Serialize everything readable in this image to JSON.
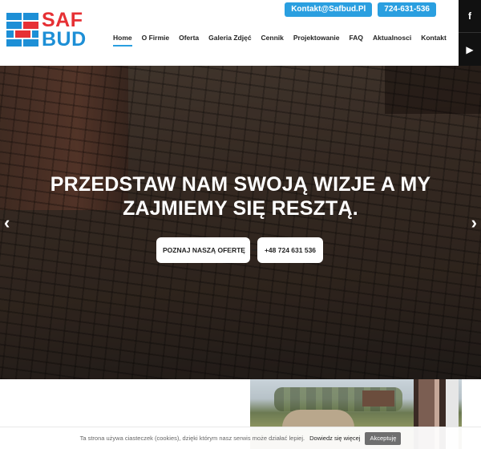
{
  "brand": {
    "logo_line1": "SAF",
    "logo_line2": "BUD",
    "colors": {
      "red": "#e63034",
      "blue": "#1d8fd6",
      "accent": "#2a9fe0"
    }
  },
  "header": {
    "email_label": "Kontakt@Safbud.Pl",
    "phone_label": "724-631-536"
  },
  "nav": {
    "items": [
      {
        "label": "Home",
        "active": true
      },
      {
        "label": "O Firmie"
      },
      {
        "label": "Oferta"
      },
      {
        "label": "Galeria Zdjęć"
      },
      {
        "label": "Cennik"
      },
      {
        "label": "Projektowanie"
      },
      {
        "label": "FAQ"
      },
      {
        "label": "Aktualnosci"
      },
      {
        "label": "Kontakt"
      }
    ]
  },
  "social": {
    "facebook_glyph": "f",
    "youtube_glyph": "▶",
    "icons": [
      "facebook-icon",
      "youtube-icon"
    ]
  },
  "hero": {
    "title_line1": "PRZEDSTAW NAM SWOJĄ WIZJE A MY",
    "title_line2": "ZAJMIEMY SIĘ RESZTĄ.",
    "offer_button": "POZNAJ NASZĄ OFERTĘ",
    "offer_arrow": "⟶",
    "phone_button": "+48 724 631 536",
    "prev_glyph": "‹",
    "next_glyph": "›"
  },
  "cookie": {
    "text": "Ta strona używa ciasteczek (cookies), dzięki którym nasz serwis może działać lepiej.",
    "link": "Dowiedz się więcej",
    "accept": "Akceptuję"
  }
}
